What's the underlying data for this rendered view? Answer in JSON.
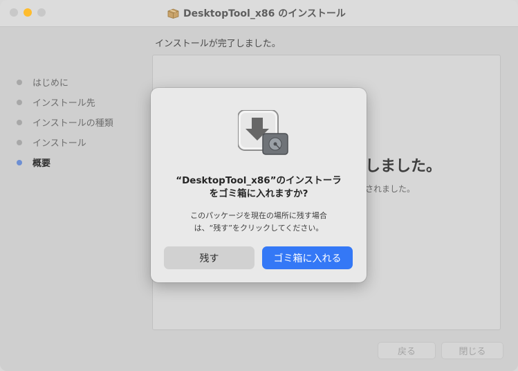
{
  "window": {
    "title": "DesktopTool_x86 のインストール",
    "heading": "インストールが完了しました。",
    "steps": [
      {
        "label": "はじめに",
        "active": false
      },
      {
        "label": "インストール先",
        "active": false
      },
      {
        "label": "インストールの種類",
        "active": false
      },
      {
        "label": "インストール",
        "active": false
      },
      {
        "label": "概要",
        "active": true
      }
    ],
    "background_text_large": "しました。",
    "background_text_small": "されました。",
    "back_label": "戻る",
    "close_label": "閉じる"
  },
  "dialog": {
    "icon": "installer-package-icon",
    "title_line1": "“DesktopTool_x86”のインストーラ",
    "title_line2": "をゴミ箱に入れますか?",
    "message_line1": "このパッケージを現在の場所に残す場合",
    "message_line2": "は、“残す”をクリックしてください。",
    "keep_label": "残す",
    "trash_label": "ゴミ箱に入れる"
  },
  "colors": {
    "accent": "#3478f6",
    "active_step_dot": "#6d8fd3",
    "minimize_light": "#febc2e"
  }
}
